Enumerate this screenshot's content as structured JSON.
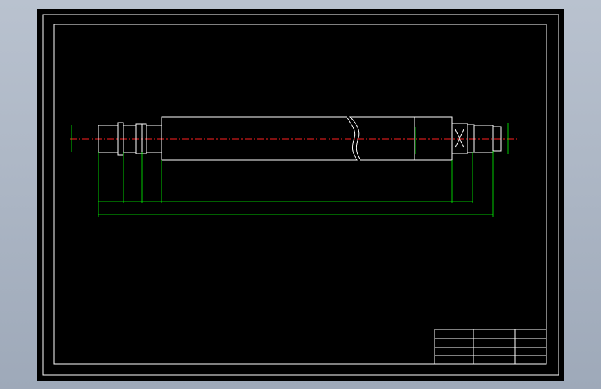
{
  "title_block": {
    "part_name": "",
    "drawing_number": "",
    "scale_row": ""
  },
  "technical_requirements": {
    "heading": "",
    "lines": [
      "",
      "",
      "",
      "",
      "",
      ""
    ]
  },
  "annotations": {
    "roughness_general": "",
    "dimension_total": "",
    "dimension_main": ""
  },
  "colors": {
    "background_outer": "#a7b0bf",
    "sheet": "#000000",
    "outline": "#ffffff",
    "dimension": "#00ff00",
    "centerline": "#ff2020"
  }
}
